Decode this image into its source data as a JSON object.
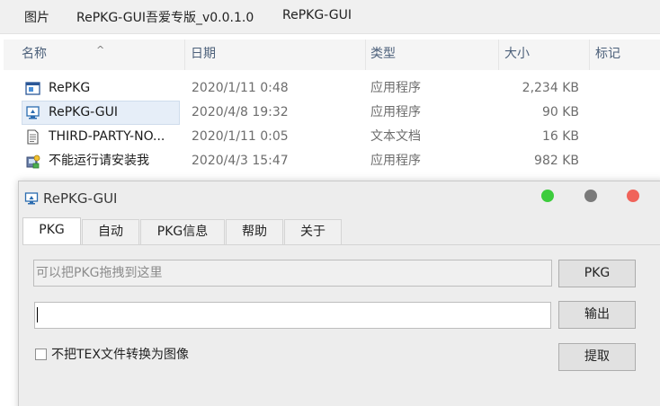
{
  "explorer": {
    "breadcrumb": [
      "图片",
      "RePKG-GUI吾爱专版_v0.0.1.0",
      "RePKG-GUI"
    ],
    "columns": {
      "name": "名称",
      "date": "日期",
      "type": "类型",
      "size": "大小",
      "tag": "标记"
    },
    "files": [
      {
        "name": "RePKG",
        "date": "2020/1/11 0:48",
        "type": "应用程序",
        "size": "2,234 KB",
        "icon": "app-window-icon"
      },
      {
        "name": "RePKG-GUI",
        "date": "2020/4/8 19:32",
        "type": "应用程序",
        "size": "90 KB",
        "icon": "app-monitor-icon"
      },
      {
        "name": "THIRD-PARTY-NO...",
        "date": "2020/1/11 0:05",
        "type": "文本文档",
        "size": "16 KB",
        "icon": "text-document-icon"
      },
      {
        "name": "不能运行请安装我",
        "date": "2020/4/3 15:47",
        "type": "应用程序",
        "size": "982 KB",
        "icon": "installer-icon"
      }
    ]
  },
  "dialog": {
    "title": "RePKG-GUI",
    "controls": {
      "green": "#3ccc3c",
      "gray": "#7a7a7a",
      "red": "#f0635a"
    },
    "tabs": [
      "PKG",
      "自动",
      "PKG信息",
      "帮助",
      "关于"
    ],
    "active_tab": 0,
    "pkg_field": {
      "placeholder": "可以把PKG拖拽到这里"
    },
    "pkg_button": "PKG",
    "output_field": {
      "value": ""
    },
    "output_button": "输出",
    "checkbox": {
      "label": "不把TEX文件转换为图像",
      "checked": false
    },
    "extract_button": "提取"
  }
}
